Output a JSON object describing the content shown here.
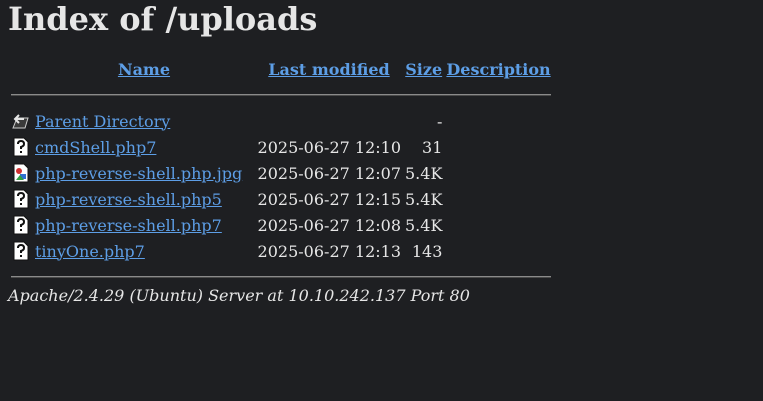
{
  "page": {
    "title": "Index of /uploads"
  },
  "columns": {
    "name": "Name",
    "last_modified": "Last modified",
    "size": "Size",
    "description": "Description"
  },
  "parent": {
    "label": "Parent Directory",
    "size": "-",
    "icon": "back-folder-icon"
  },
  "rows": [
    {
      "name": "cmdShell.php7",
      "date": "2025-06-27 12:10",
      "size": "31",
      "icon": "unknown-file-icon"
    },
    {
      "name": "php-reverse-shell.php.jpg",
      "date": "2025-06-27 12:07",
      "size": "5.4K",
      "icon": "image-file-icon"
    },
    {
      "name": "php-reverse-shell.php5",
      "date": "2025-06-27 12:15",
      "size": "5.4K",
      "icon": "unknown-file-icon"
    },
    {
      "name": "php-reverse-shell.php7",
      "date": "2025-06-27 12:08",
      "size": "5.4K",
      "icon": "unknown-file-icon"
    },
    {
      "name": "tinyOne.php7",
      "date": "2025-06-27 12:13",
      "size": "143",
      "icon": "unknown-file-icon"
    }
  ],
  "footer": {
    "address": "Apache/2.4.29 (Ubuntu) Server at 10.10.242.137 Port 80"
  },
  "colors": {
    "background": "#1e1f22",
    "link": "#5d9ee6",
    "text": "#e6e6e6"
  }
}
